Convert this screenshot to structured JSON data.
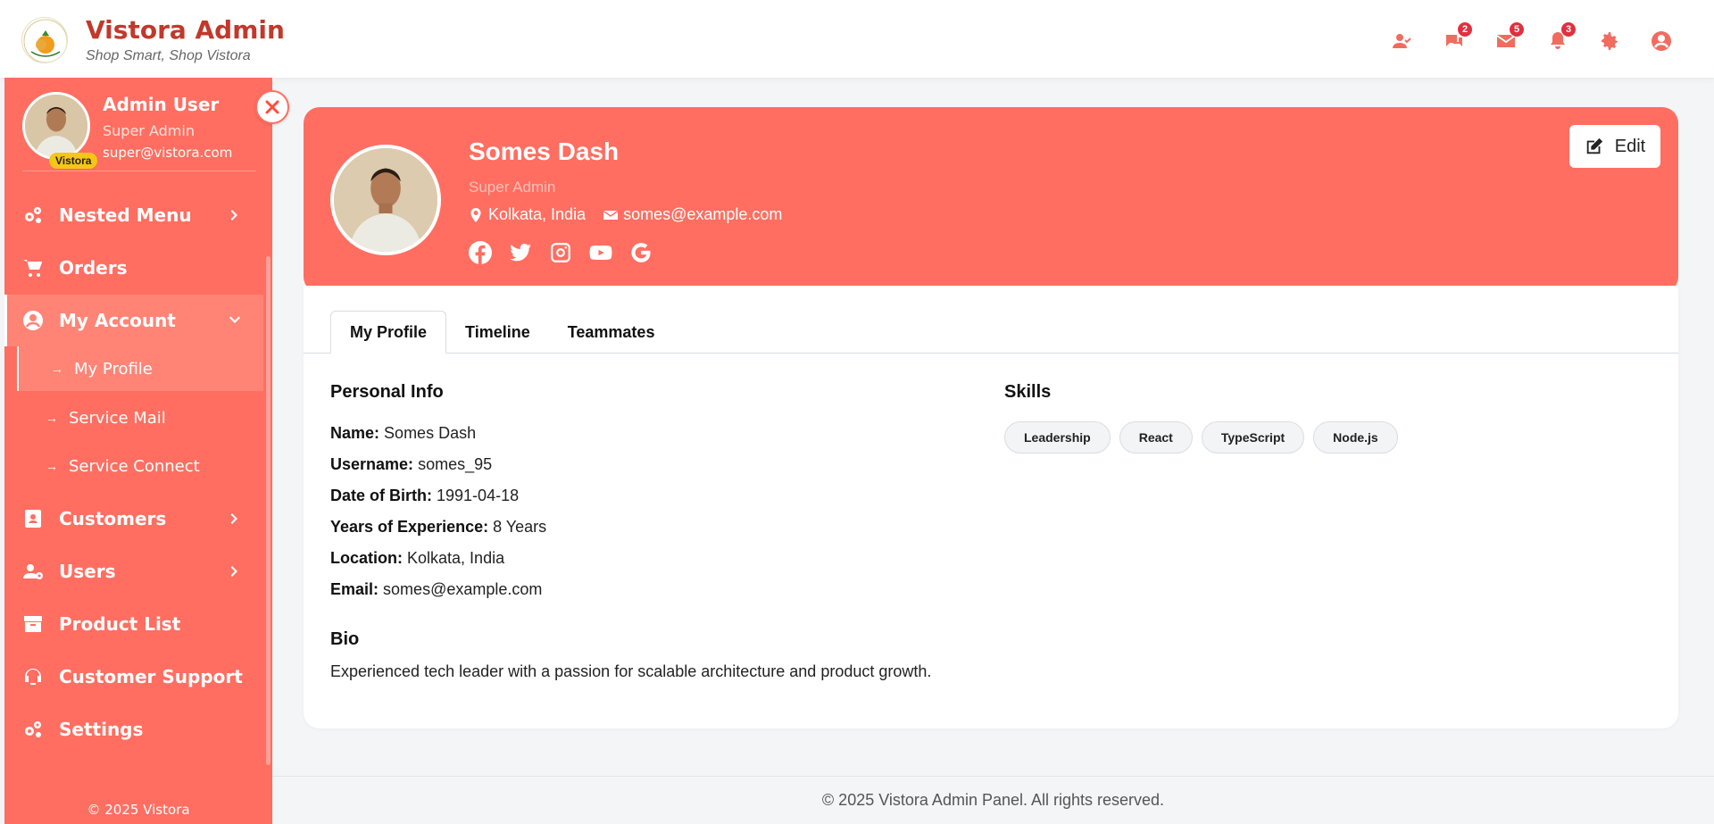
{
  "brand": {
    "title": "Vistora Admin",
    "tagline": "Shop Smart, Shop Vistora",
    "accent_color": "#c0392b"
  },
  "header_icons": [
    {
      "icon": "user-check-icon",
      "badge": ""
    },
    {
      "icon": "chat-icon",
      "badge": "2"
    },
    {
      "icon": "envelope-icon",
      "badge": "5"
    },
    {
      "icon": "bell-icon",
      "badge": "3"
    },
    {
      "icon": "gear-icon",
      "badge": ""
    },
    {
      "icon": "user-circle-icon",
      "badge": ""
    }
  ],
  "sidebar": {
    "background": "#ff6e61",
    "user": {
      "name": "Admin User",
      "role": "Super Admin",
      "email": "super@vistora.com",
      "tag": "Vistora"
    },
    "items": [
      {
        "label": "Nested Menu",
        "icon": "gears-icon",
        "has_chevron": true
      },
      {
        "label": "Orders",
        "icon": "cart-icon",
        "has_chevron": false
      },
      {
        "label": "My Account",
        "icon": "user-circle-icon",
        "has_chevron": true,
        "expanded": true
      },
      {
        "label": "Customers",
        "icon": "contact-card-icon",
        "has_chevron": true
      },
      {
        "label": "Users",
        "icon": "user-gear-icon",
        "has_chevron": true
      },
      {
        "label": "Product List",
        "icon": "box-icon",
        "has_chevron": false
      },
      {
        "label": "Customer Support",
        "icon": "headset-icon",
        "has_chevron": false
      },
      {
        "label": "Settings",
        "icon": "gears-icon",
        "has_chevron": false
      }
    ],
    "sub_items": [
      {
        "label": "My Profile",
        "active": true
      },
      {
        "label": "Service Mail",
        "active": false
      },
      {
        "label": "Service Connect",
        "active": false
      }
    ],
    "footer": "© 2025 Vistora"
  },
  "profile": {
    "name": "Somes Dash",
    "role": "Super Admin",
    "location": "Kolkata, India",
    "email": "somes@example.com",
    "edit_label": "Edit",
    "social": [
      "facebook-icon",
      "twitter-icon",
      "instagram-icon",
      "youtube-icon",
      "google-icon"
    ]
  },
  "tabs": [
    "My Profile",
    "Timeline",
    "Teammates"
  ],
  "personal_info": {
    "title": "Personal Info",
    "rows": [
      {
        "label": "Name:",
        "value": "Somes Dash"
      },
      {
        "label": "Username:",
        "value": "somes_95"
      },
      {
        "label": "Date of Birth:",
        "value": "1991-04-18"
      },
      {
        "label": "Years of Experience:",
        "value": "8 Years"
      },
      {
        "label": "Location:",
        "value": "Kolkata, India"
      },
      {
        "label": "Email:",
        "value": "somes@example.com"
      }
    ]
  },
  "skills": {
    "title": "Skills",
    "items": [
      "Leadership",
      "React",
      "TypeScript",
      "Node.js"
    ]
  },
  "bio": {
    "title": "Bio",
    "text": "Experienced tech leader with a passion for scalable architecture and product growth."
  },
  "footer": "© 2025 Vistora Admin Panel. All rights reserved."
}
